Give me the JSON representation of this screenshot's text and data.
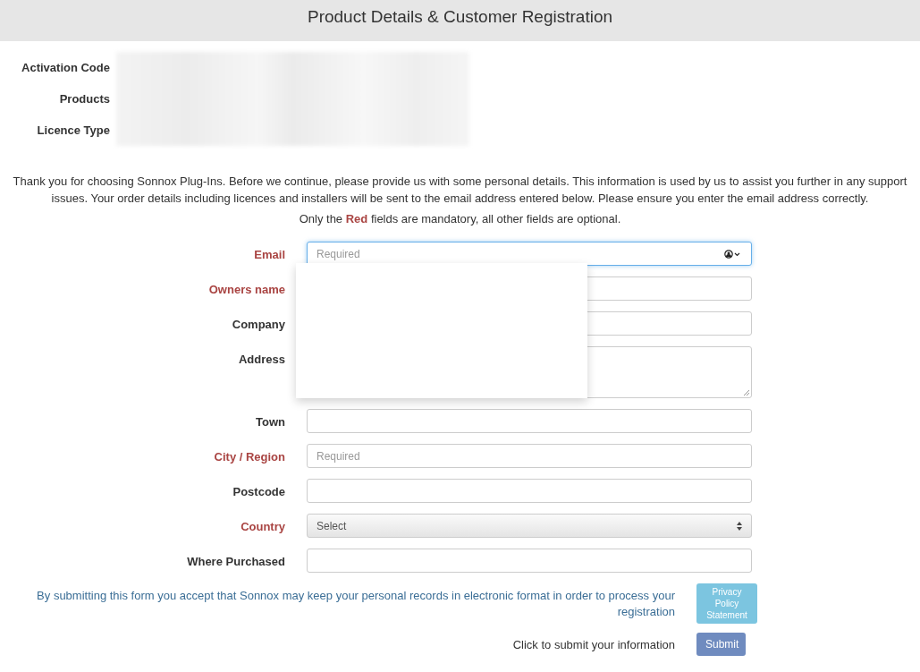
{
  "header": {
    "title": "Product Details & Customer Registration"
  },
  "summary": [
    {
      "label": "Activation Code"
    },
    {
      "label": "Products"
    },
    {
      "label": "Licence Type"
    }
  ],
  "intro": "Thank you for choosing Sonnox Plug-Ins. Before we continue, please provide us with some personal details. This information is used by us to assist you further in any support issues. Your order details including licences and installers will be sent to the email address entered below. Please ensure you enter the email address correctly.",
  "mandatory_note": "Only the **Red** fields are mandatory, all other fields are optional.",
  "fields": [
    {
      "label": "Email",
      "kind": "input",
      "required": true,
      "focused": true,
      "placeholder": "Required"
    },
    {
      "label": "Owners name",
      "kind": "input",
      "required": true,
      "focused": false
    },
    {
      "label": "Company",
      "kind": "input",
      "required": false,
      "focused": false
    },
    {
      "label": "Address",
      "kind": "textarea",
      "required": false,
      "focused": false
    },
    {
      "label": "Town",
      "kind": "input",
      "required": false,
      "focused": false
    },
    {
      "label": "City / Region",
      "kind": "input",
      "required": true,
      "focused": false,
      "placeholder": "Required"
    },
    {
      "label": "Postcode",
      "kind": "input",
      "required": false,
      "focused": false
    },
    {
      "label": "Country",
      "kind": "select",
      "required": true,
      "focused": false,
      "value": "Select"
    },
    {
      "label": "Where Purchased",
      "kind": "input",
      "required": false,
      "focused": false
    }
  ],
  "autofill_popup": {
    "open": true
  },
  "consent": {
    "text": "By submitting this form you accept that Sonnox may keep your personal records in electronic format in order to process your registration",
    "button": "Privacy Policy Statement"
  },
  "submit": {
    "text": "Click to submit your information",
    "button": "Submit"
  }
}
